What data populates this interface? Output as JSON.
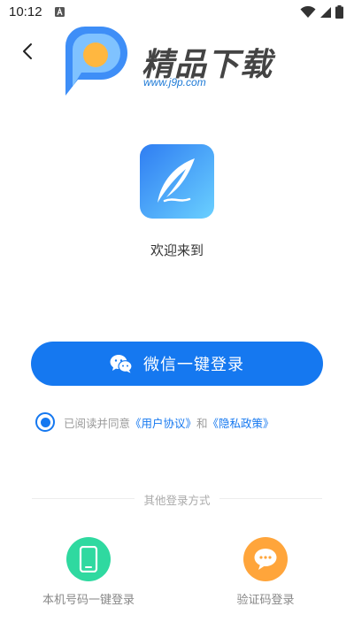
{
  "status_bar": {
    "time": "10:12",
    "icons": [
      "notification-a-icon",
      "wifi-icon",
      "signal-icon",
      "battery-icon"
    ]
  },
  "watermark": {
    "title": "精品下载",
    "url": "www.j9p.com"
  },
  "welcome_text": "欢迎来到",
  "wechat_login": {
    "label": "微信一键登录",
    "icon": "wechat-icon"
  },
  "agreement": {
    "checked": true,
    "prefix": "已阅读并同意",
    "user_agreement": "《用户协议》",
    "conjunction": "和",
    "privacy_policy": "《隐私政策》"
  },
  "other_methods": {
    "title": "其他登录方式",
    "phone_login": {
      "label": "本机号码一键登录",
      "icon": "phone-icon"
    },
    "code_login": {
      "label": "验证码登录",
      "icon": "chat-bubble-icon"
    }
  },
  "colors": {
    "primary": "#1578f0",
    "phone_green": "#2fd9a0",
    "code_orange": "#ffa53b"
  }
}
